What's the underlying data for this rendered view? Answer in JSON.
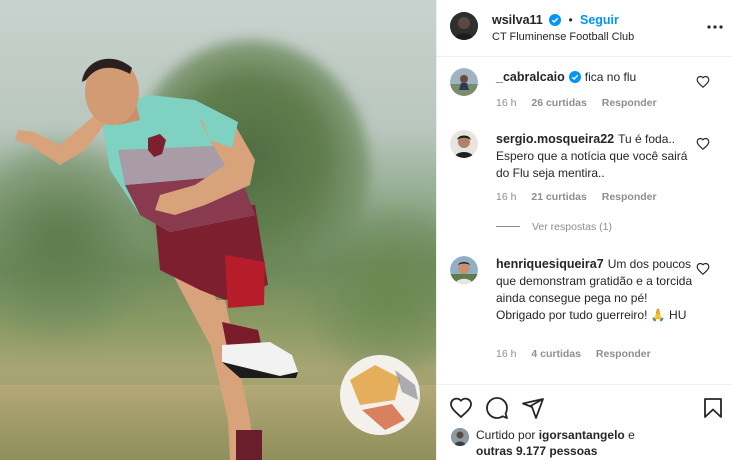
{
  "post": {
    "username": "wsilva11",
    "follow_label": "Seguir",
    "separator": "•",
    "location": "CT Fluminense Football Club"
  },
  "comments": [
    {
      "username": "_cabralcaio",
      "verified": true,
      "text": "fica no flu",
      "time": "16 h",
      "likes": "26 curtidas",
      "reply": "Responder"
    },
    {
      "username": "sergio.mosqueira22",
      "verified": false,
      "text": "Tu é foda.. Espero que a notícia que você sairá do Flu seja mentira..",
      "time": "16 h",
      "likes": "21 curtidas",
      "reply": "Responder",
      "view_replies": "Ver respostas (1)"
    },
    {
      "username": "henriquesiqueira7",
      "verified": false,
      "text": "Um dos poucos que demonstram gratidão e a torcida ainda consegue pega no pé! Obrigado por tudo guerreiro! 🙏 HU",
      "time": "16 h",
      "likes": "4 curtidas",
      "reply": "Responder"
    }
  ],
  "likes_summary": {
    "prefix": "Curtido por",
    "user": "igorsantangelo",
    "mid": "e",
    "others": "outras 9.177 pessoas"
  },
  "icons": {
    "verified": "verified-badge-icon",
    "more": "more-options-icon",
    "like": "heart-icon",
    "comment": "comment-icon",
    "share": "share-icon",
    "save": "bookmark-icon"
  },
  "colors": {
    "accent": "#0095f6",
    "muted": "#8e8e8e",
    "text": "#262626"
  }
}
